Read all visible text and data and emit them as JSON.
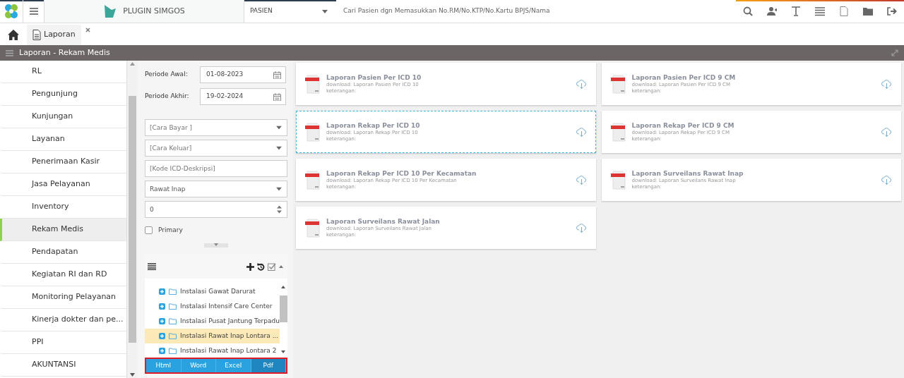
{
  "topbar": {
    "app_name": "PLUGIN SIMGOS",
    "patient_select": "PASIEN",
    "search_placeholder": "Cari Pasien dgn Memasukkan No.RM/No.KTP/No.Kartu BPJS/Nama"
  },
  "tabs": [
    {
      "label": "Laporan",
      "selected": true
    }
  ],
  "section_title": "Laporan - Rekam Medis",
  "sidebar": {
    "items": [
      {
        "label": "RL",
        "selected": false
      },
      {
        "label": "Pengunjung",
        "selected": false
      },
      {
        "label": "Kunjungan",
        "selected": false
      },
      {
        "label": "Layanan",
        "selected": false
      },
      {
        "label": "Penerimaan Kasir",
        "selected": false
      },
      {
        "label": "Jasa Pelayanan",
        "selected": false
      },
      {
        "label": "Inventory",
        "selected": false
      },
      {
        "label": "Rekam Medis",
        "selected": true
      },
      {
        "label": "Pendapatan",
        "selected": false
      },
      {
        "label": "Kegiatan RI dan RD",
        "selected": false
      },
      {
        "label": "Monitoring Pelayanan",
        "selected": false
      },
      {
        "label": "Kinerja dokter dan pe...",
        "selected": false
      },
      {
        "label": "PPI",
        "selected": false
      },
      {
        "label": "AKUNTANSI",
        "selected": false
      }
    ]
  },
  "filters": {
    "periode_awal": {
      "label": "Periode Awal:",
      "value": "01-08-2023"
    },
    "periode_akhir": {
      "label": "Periode Akhir:",
      "value": "19-02-2024"
    },
    "fields": [
      {
        "kind": "select",
        "placeholder": "[Cara Bayar ]"
      },
      {
        "kind": "select",
        "placeholder": "[Cara Keluar]"
      },
      {
        "kind": "text",
        "placeholder": "[Kode ICD-Deskripsi]"
      },
      {
        "kind": "select",
        "value": "Rawat Inap"
      },
      {
        "kind": "number",
        "value": "0"
      }
    ],
    "primary": {
      "label": "Primary",
      "checked": false
    }
  },
  "tree": {
    "items": [
      {
        "label": "Instalasi Gawat Darurat",
        "selected": false
      },
      {
        "label": "Instalasi Intensif Care Center",
        "selected": false
      },
      {
        "label": "Instalasi Pusat Jantung Terpadu",
        "selected": false
      },
      {
        "label": "Instalasi Rawat Inap Lontara ...",
        "selected": true
      },
      {
        "label": "Instalasi Rawat Inap Lontara 2",
        "selected": false
      }
    ]
  },
  "export_buttons": [
    {
      "label": "Html",
      "selected": false
    },
    {
      "label": "Word",
      "selected": false
    },
    {
      "label": "Excel",
      "selected": false
    },
    {
      "label": "Pdf",
      "selected": true
    }
  ],
  "reports": [
    {
      "title": "Laporan Pasien Per ICD 10",
      "download": "download: Laporan Pasien Per ICD 10",
      "note": "keterangan:",
      "selected": false
    },
    {
      "title": "Laporan Pasien Per ICD 9 CM",
      "download": "download: Laporan Pasien Per ICD 9 CM",
      "note": "keterangan:",
      "selected": false
    },
    {
      "title": "Laporan Rekap Per ICD 10",
      "download": "download: Laporan Rekap Per ICD 10",
      "note": "keterangan:",
      "selected": true
    },
    {
      "title": "Laporan Rekap Per ICD 9 CM",
      "download": "download: Laporan Rekap Per ICD 9 CM",
      "note": "keterangan:",
      "selected": false
    },
    {
      "title": "Laporan Rekap Per ICD 10 Per Kecamatan",
      "download": "download: Laporan Rekap Per ICD 10 Per Kecamatan",
      "note": "keterangan:",
      "selected": false
    },
    {
      "title": "Laporan Surveilans Rawat Inap",
      "download": "download: Laporan Surveilans Rawat Inap",
      "note": "keterangan:",
      "selected": false
    },
    {
      "title": "Laporan Surveilans Rawat Jalan",
      "download": "download: Laporan Surveilans Rawat Jalan",
      "note": "keterangan:",
      "selected": false
    }
  ]
}
